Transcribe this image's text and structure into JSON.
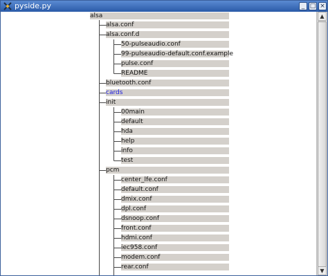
{
  "window": {
    "title": "pyside.py",
    "minimize_label": "_",
    "maximize_label": "□",
    "close_label": "×"
  },
  "scrollbar": {
    "up_label": "▲",
    "down_label": "▼"
  },
  "tree": {
    "root": "alsa",
    "alsa_conf": "alsa.conf",
    "alsa_conf_d": "alsa.conf.d",
    "conf_50_pulseaudio": "50-pulseaudio.conf",
    "conf_99_pulseaudio_default": "99-pulseaudio-default.conf.example",
    "pulse_conf": "pulse.conf",
    "readme": "README",
    "bluetooth_conf": "bluetooth.conf",
    "cards": "cards",
    "init": "init",
    "init_00main": "00main",
    "init_default": "default",
    "init_hda": "hda",
    "init_help": "help",
    "init_info": "info",
    "init_test": "test",
    "pcm": "pcm",
    "pcm_center_lfe": "center_lfe.conf",
    "pcm_default": "default.conf",
    "pcm_dmix": "dmix.conf",
    "pcm_dpl": "dpl.conf",
    "pcm_dsnoop": "dsnoop.conf",
    "pcm_front": "front.conf",
    "pcm_hdmi": "hdmi.conf",
    "pcm_iec958": "iec958.conf",
    "pcm_modem": "modem.conf",
    "pcm_rear": "rear.conf"
  }
}
